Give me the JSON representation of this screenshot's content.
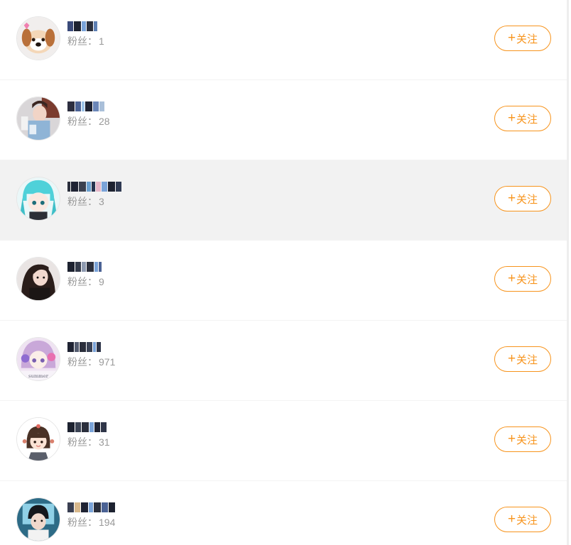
{
  "accent_color": "#f7941d",
  "follow_label": "关注",
  "plus_icon": "plus-icon",
  "fans_label": "粉丝：",
  "users": [
    {
      "fans": "1",
      "avatar": "puppy-avatar",
      "name_pixels": 3
    },
    {
      "fans": "28",
      "avatar": "girl-photo-avatar",
      "name_pixels": 4
    },
    {
      "fans": "3",
      "avatar": "anime-cyan-hair-avatar",
      "name_pixels": 8
    },
    {
      "fans": "9",
      "avatar": "girl-dark-hair-avatar",
      "name_pixels": 5
    },
    {
      "fans": "971",
      "avatar": "anime-purple-avatar",
      "name_pixels": 5
    },
    {
      "fans": "31",
      "avatar": "cartoon-girl-avatar",
      "name_pixels": 5
    },
    {
      "fans": "194",
      "avatar": "boy-photo-avatar",
      "name_pixels": 6
    }
  ]
}
